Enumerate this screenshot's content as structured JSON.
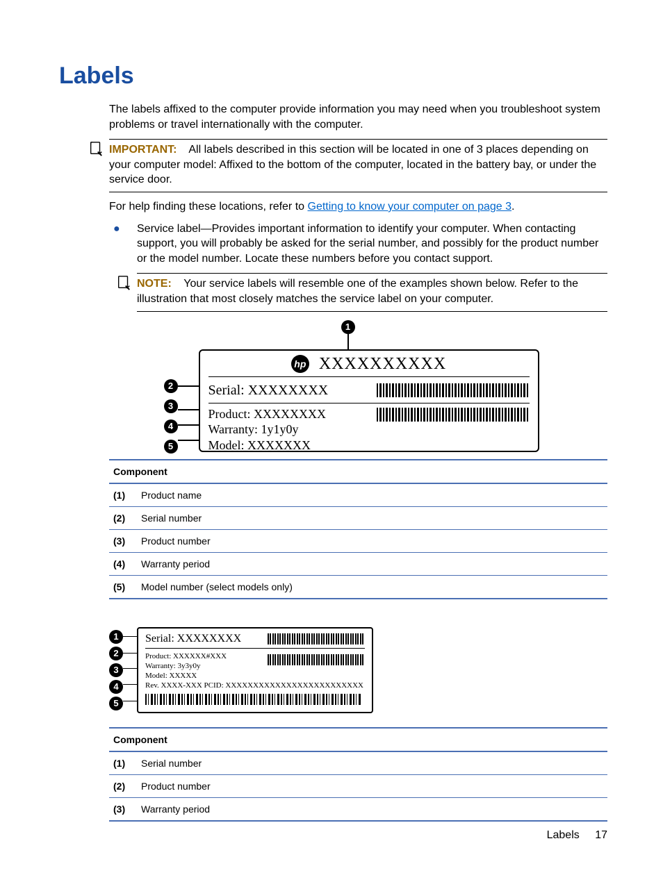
{
  "heading": "Labels",
  "intro": "The labels affixed to the computer provide information you may need when you troubleshoot system problems or travel internationally with the computer.",
  "important": {
    "label": "IMPORTANT:",
    "text": "All labels described in this section will be located in one of 3 places depending on your computer model: Affixed to the bottom of the computer, located in the battery bay, or under the service door."
  },
  "help_prefix": "For help finding these locations, refer to ",
  "help_link": "Getting to know your computer on page 3",
  "help_suffix": ".",
  "bullet": "Service label—Provides important information to identify your computer. When contacting support, you will probably be asked for the serial number, and possibly for the product number or the model number. Locate these numbers before you contact support.",
  "note": {
    "label": "NOTE:",
    "text": "Your service labels will resemble one of the examples shown below. Refer to the illustration that most closely matches the service label on your computer."
  },
  "dia1": {
    "title": "XXXXXXXXXX",
    "serial": "Serial:  XXXXXXXX",
    "product": "Product: XXXXXXXX",
    "warranty": "Warranty: 1y1y0y",
    "model": "Model: XXXXXXX"
  },
  "table1": {
    "header": "Component",
    "rows": [
      {
        "n": "(1)",
        "d": "Product name"
      },
      {
        "n": "(2)",
        "d": "Serial number"
      },
      {
        "n": "(3)",
        "d": "Product number"
      },
      {
        "n": "(4)",
        "d": "Warranty period"
      },
      {
        "n": "(5)",
        "d": "Model number (select models only)"
      }
    ]
  },
  "dia2": {
    "serial": "Serial:  XXXXXXXX",
    "product": "Product: XXXXXX#XXX",
    "warranty": "Warranty: 3y3y0y",
    "model": "Model: XXXXX",
    "rev": "Rev. XXXX-XXX  PCID: XXXXXXXXXXXXXXXXXXXXXXXXX"
  },
  "table2": {
    "header": "Component",
    "rows": [
      {
        "n": "(1)",
        "d": "Serial number"
      },
      {
        "n": "(2)",
        "d": "Product number"
      },
      {
        "n": "(3)",
        "d": "Warranty period"
      }
    ]
  },
  "footer": {
    "section": "Labels",
    "page": "17"
  }
}
